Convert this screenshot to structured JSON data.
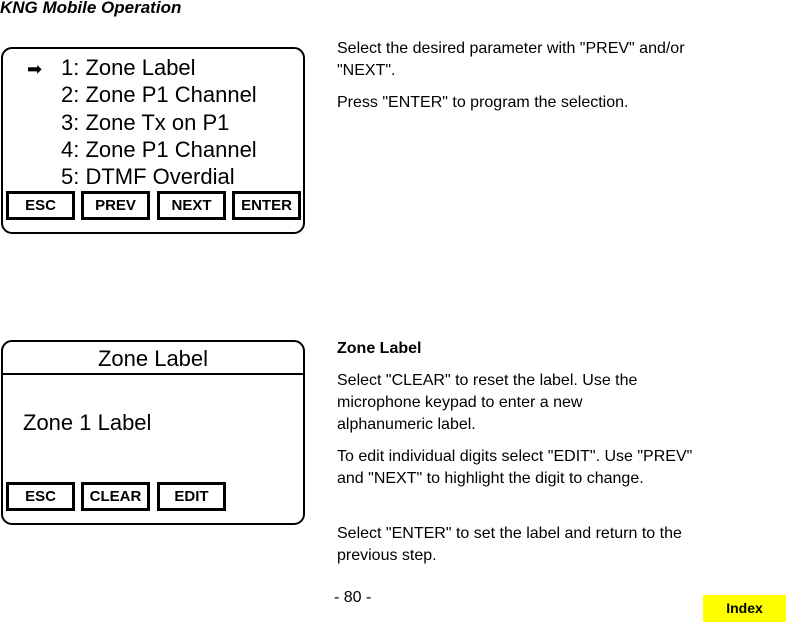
{
  "header": {
    "title": "KNG Mobile Operation"
  },
  "screen1": {
    "selection_arrow_icon": "arrow-right-icon",
    "menu_items": [
      "1: Zone Label",
      "2: Zone P1 Channel",
      "3: Zone Tx on P1",
      "4: Zone P1 Channel",
      "5: DTMF Overdial"
    ],
    "selected_index": 0,
    "softkeys": [
      "ESC",
      "PREV",
      "NEXT",
      "ENTER"
    ]
  },
  "screen1_text": {
    "paragraphs": [
      "Select the desired parameter with \"PREV\" and/or \"NEXT\".",
      "Press \"ENTER\" to program the selection."
    ]
  },
  "screen2": {
    "title": "Zone Label",
    "value": "Zone 1 Label",
    "softkeys": [
      "ESC",
      "CLEAR",
      "EDIT"
    ]
  },
  "screen2_text": {
    "heading": "Zone Label",
    "paragraphs": [
      "Select \"CLEAR\" to reset the label. Use the microphone keypad to enter a new alphanumeric label.",
      "To edit individual digits select \"EDIT\". Use \"PREV\" and \"NEXT\" to highlight the digit to change.",
      "Select \"ENTER\" to set the label and return to the previous step."
    ]
  },
  "footer": {
    "page_number": "- 80 -",
    "index_label": "Index",
    "index_color": "#ffff00"
  }
}
